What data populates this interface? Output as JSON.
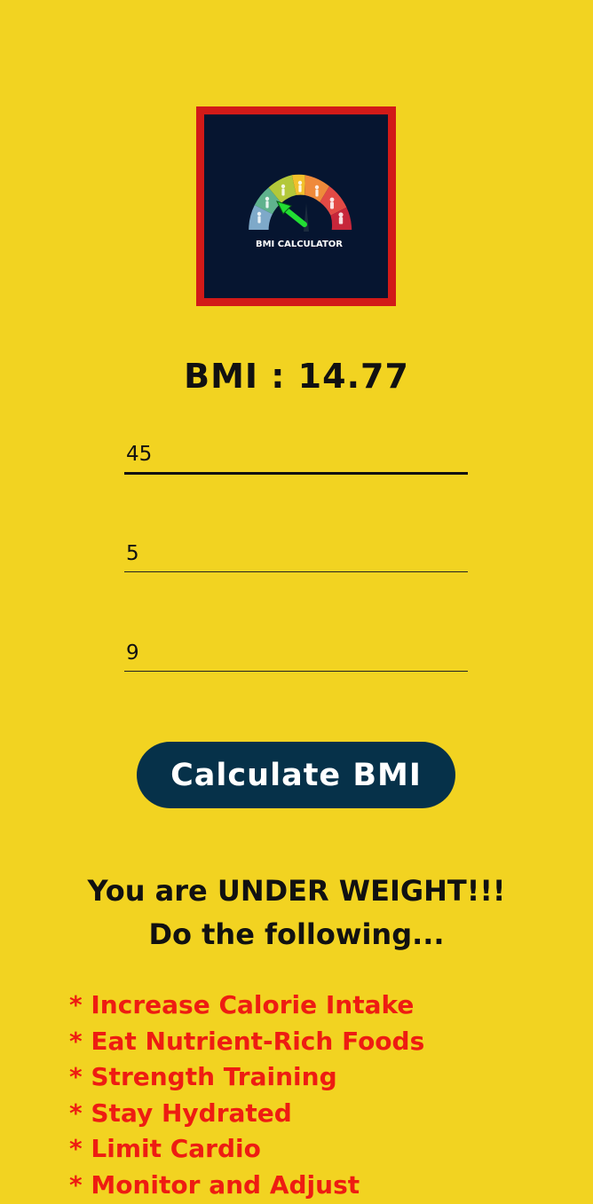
{
  "logo": {
    "caption": "BMI CALCULATOR",
    "colors": {
      "frame": "#d21a18",
      "background": "#061530",
      "gauge": [
        "#7ea9c9",
        "#5fb28d",
        "#b3c83a",
        "#f2c02b",
        "#ef8a3a",
        "#e34a45",
        "#c7263a"
      ],
      "needle": "#22dd33"
    }
  },
  "result": {
    "text": "BMI : 14.77"
  },
  "inputs": {
    "weight": "45",
    "feet": "5",
    "inches": "9"
  },
  "calculate_button": {
    "label": "Calculate BMI"
  },
  "advice": {
    "line1": "You are UNDER WEIGHT!!!",
    "line2": "Do the following...",
    "tips": [
      "* Increase Calorie Intake",
      "* Eat Nutrient-Rich Foods",
      "* Strength Training",
      "* Stay Hydrated",
      "* Limit Cardio",
      "* Monitor and Adjust"
    ]
  },
  "theme": {
    "background": "#f2d321",
    "button": "#063149",
    "tip_text": "#ee1c12"
  }
}
